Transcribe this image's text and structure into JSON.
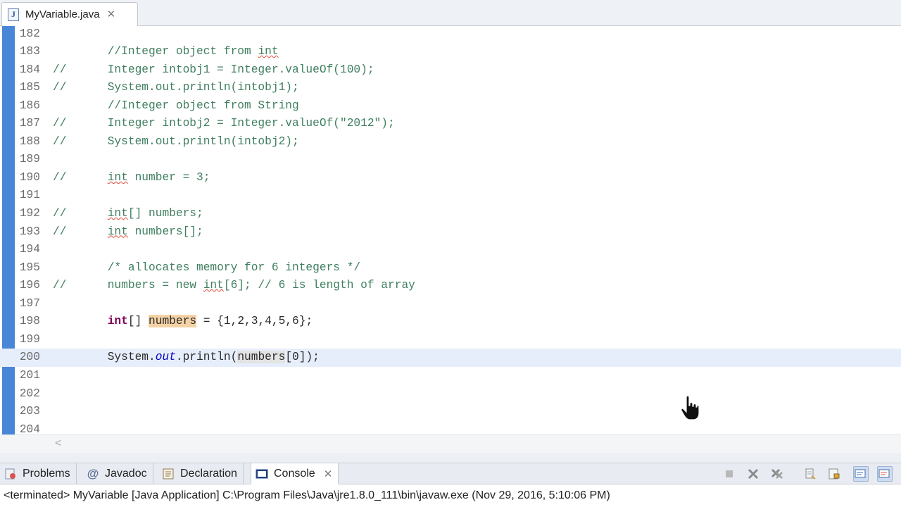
{
  "editor_tab": {
    "label": "MyVariable.java",
    "icon": "java-file-icon"
  },
  "code_lines": [
    {
      "num": "182",
      "segs": []
    },
    {
      "num": "183",
      "segs": [
        {
          "t": "        //Integer object from ",
          "c": "cm"
        },
        {
          "t": "int",
          "c": "cm squig"
        }
      ]
    },
    {
      "num": "184",
      "segs": [
        {
          "t": "//      Integer intobj1 = Integer.valueOf(100);",
          "c": "cm"
        }
      ]
    },
    {
      "num": "185",
      "segs": [
        {
          "t": "//      System.out.println(intobj1);",
          "c": "cm"
        }
      ]
    },
    {
      "num": "186",
      "segs": [
        {
          "t": "        //Integer object from String",
          "c": "cm"
        }
      ]
    },
    {
      "num": "187",
      "segs": [
        {
          "t": "//      Integer intobj2 = Integer.valueOf(\"2012\");",
          "c": "cm"
        }
      ]
    },
    {
      "num": "188",
      "segs": [
        {
          "t": "//      System.out.println(intobj2);",
          "c": "cm"
        }
      ]
    },
    {
      "num": "189",
      "segs": []
    },
    {
      "num": "190",
      "segs": [
        {
          "t": "//      ",
          "c": "cm"
        },
        {
          "t": "int",
          "c": "cm squig"
        },
        {
          "t": " number = 3;",
          "c": "cm"
        }
      ]
    },
    {
      "num": "191",
      "segs": []
    },
    {
      "num": "192",
      "segs": [
        {
          "t": "//      ",
          "c": "cm"
        },
        {
          "t": "int",
          "c": "cm squig"
        },
        {
          "t": "[] numbers;",
          "c": "cm"
        }
      ]
    },
    {
      "num": "193",
      "segs": [
        {
          "t": "//      ",
          "c": "cm"
        },
        {
          "t": "int",
          "c": "cm squig"
        },
        {
          "t": " numbers[];",
          "c": "cm"
        }
      ]
    },
    {
      "num": "194",
      "segs": []
    },
    {
      "num": "195",
      "segs": [
        {
          "t": "        /* allocates memory for 6 integers */",
          "c": "cm"
        }
      ]
    },
    {
      "num": "196",
      "segs": [
        {
          "t": "//      numbers = new ",
          "c": "cm"
        },
        {
          "t": "int",
          "c": "cm squig"
        },
        {
          "t": "[6]; // 6 is length of array",
          "c": "cm"
        }
      ]
    },
    {
      "num": "197",
      "segs": []
    },
    {
      "num": "198",
      "segs": [
        {
          "t": "        ",
          "c": ""
        },
        {
          "t": "int",
          "c": "kw"
        },
        {
          "t": "[] ",
          "c": ""
        },
        {
          "t": "numbers",
          "c": "hl-decl"
        },
        {
          "t": " = {1,2,3,4,5,6};",
          "c": ""
        }
      ]
    },
    {
      "num": "199",
      "segs": []
    },
    {
      "num": "200",
      "segs": [
        {
          "t": "        System.",
          "c": ""
        },
        {
          "t": "out",
          "c": "fld"
        },
        {
          "t": ".println(",
          "c": ""
        },
        {
          "t": "numbers",
          "c": "hl-occ"
        },
        {
          "t": "[0]);",
          "c": ""
        }
      ],
      "current": true
    },
    {
      "num": "201",
      "segs": []
    },
    {
      "num": "202",
      "segs": []
    },
    {
      "num": "203",
      "segs": []
    },
    {
      "num": "204",
      "segs": []
    }
  ],
  "views": {
    "tabs": [
      {
        "label": "Problems",
        "icon": "problems-icon",
        "name": "tab-problems"
      },
      {
        "label": "Javadoc",
        "icon": "javadoc-icon",
        "name": "tab-javadoc"
      },
      {
        "label": "Declaration",
        "icon": "declaration-icon",
        "name": "tab-declaration"
      },
      {
        "label": "Console",
        "icon": "console-icon",
        "name": "tab-console",
        "active": true
      }
    ]
  },
  "status": {
    "text": "<terminated> MyVariable [Java Application] C:\\Program Files\\Java\\jre1.8.0_111\\bin\\javaw.exe (Nov 29, 2016, 5:10:06 PM)"
  },
  "colors": {
    "accent": "#4a86d6",
    "comment": "#3f7f5f",
    "keyword": "#7f0055",
    "field": "#0000c0",
    "current_line": "#e7eefb"
  }
}
